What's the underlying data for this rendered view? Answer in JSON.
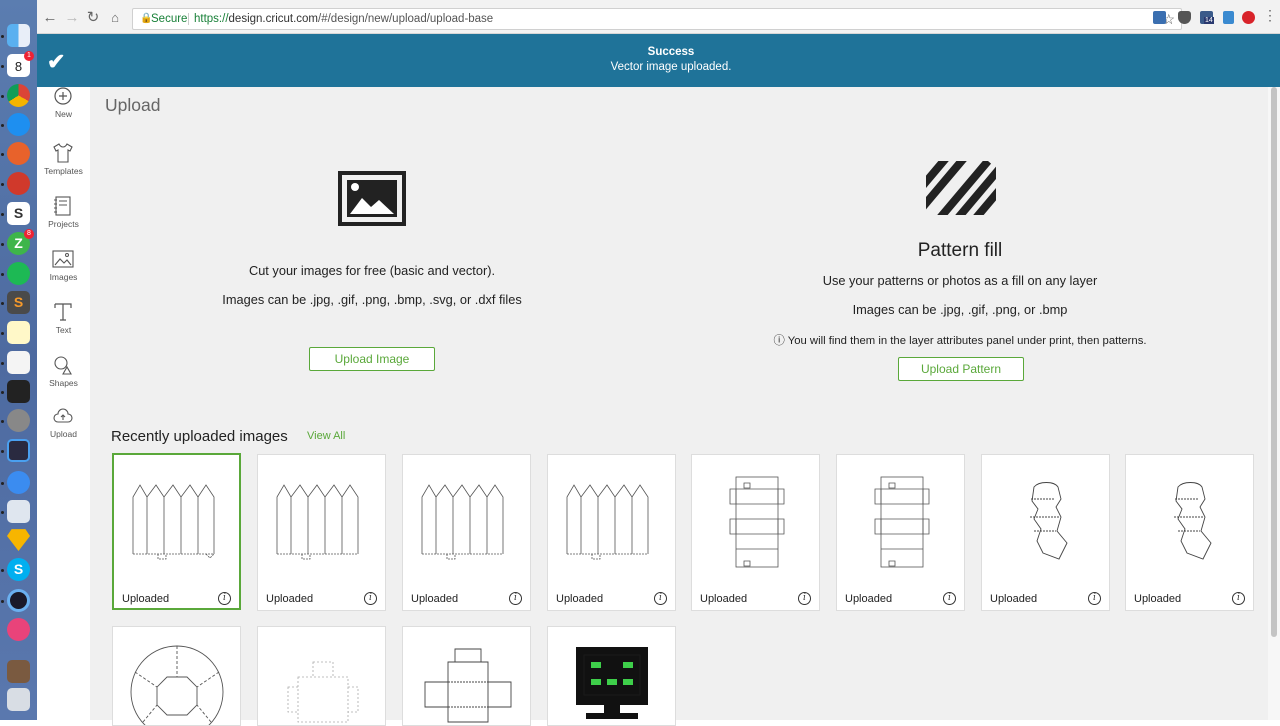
{
  "browser": {
    "secure_label": "Secure",
    "url_scheme": "https://",
    "url_host": "design.cricut.com",
    "url_path": "/#/design/new/upload/upload-base",
    "ext_badge_count": "14"
  },
  "dock": {
    "calendar_day": "8",
    "calendar_badge": "1",
    "z_badge": "8"
  },
  "notification": {
    "title": "Success",
    "message": "Vector image uploaded."
  },
  "sidebar": {
    "items": [
      {
        "label": "New",
        "icon": "plus-circle-icon"
      },
      {
        "label": "Templates",
        "icon": "tshirt-icon"
      },
      {
        "label": "Projects",
        "icon": "notebook-icon"
      },
      {
        "label": "Images",
        "icon": "image-icon"
      },
      {
        "label": "Text",
        "icon": "text-icon"
      },
      {
        "label": "Shapes",
        "icon": "shapes-icon"
      },
      {
        "label": "Upload",
        "icon": "cloud-upload-icon"
      }
    ]
  },
  "page": {
    "title": "Upload"
  },
  "image_panel": {
    "line1": "Cut your images for free (basic and vector).",
    "line2": "Images can be .jpg, .gif, .png, .bmp, .svg, or .dxf files",
    "button": "Upload Image"
  },
  "pattern_panel": {
    "title": "Pattern fill",
    "line1": "Use your patterns or photos as a fill on any layer",
    "line2": "Images can be .jpg, .gif, .png, or .bmp",
    "info": "ⓘ You will find them in the layer attributes panel under print, then patterns.",
    "button": "Upload Pattern"
  },
  "recent": {
    "title": "Recently uploaded images",
    "view_all": "View All",
    "tiles": [
      {
        "label": "Uploaded"
      },
      {
        "label": "Uploaded"
      },
      {
        "label": "Uploaded"
      },
      {
        "label": "Uploaded"
      },
      {
        "label": "Uploaded"
      },
      {
        "label": "Uploaded"
      },
      {
        "label": "Uploaded"
      },
      {
        "label": "Uploaded"
      }
    ]
  },
  "colors": {
    "accent": "#5aa83a",
    "notification_bg": "#1f7399"
  }
}
